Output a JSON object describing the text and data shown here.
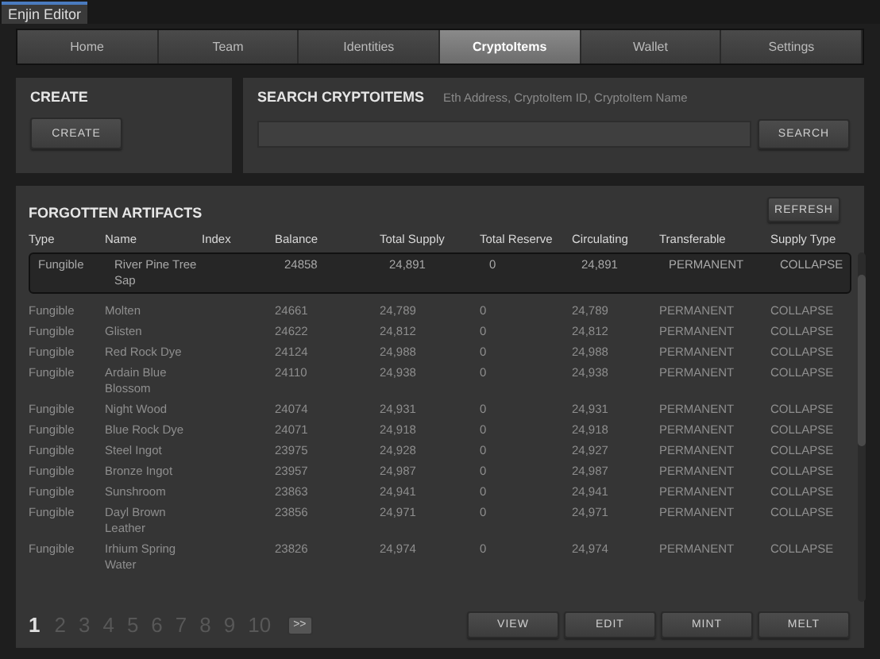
{
  "window": {
    "title": "Enjin Editor"
  },
  "tabs": [
    {
      "label": "Home",
      "selected": false
    },
    {
      "label": "Team",
      "selected": false
    },
    {
      "label": "Identities",
      "selected": false
    },
    {
      "label": "CryptoItems",
      "selected": true
    },
    {
      "label": "Wallet",
      "selected": false
    },
    {
      "label": "Settings",
      "selected": false
    }
  ],
  "create": {
    "title": "CREATE",
    "button": "CREATE"
  },
  "search": {
    "title": "SEARCH CRYPTOITEMS",
    "hint": "Eth Address, CryptoItem ID, CryptoItem Name",
    "button": "SEARCH"
  },
  "table": {
    "title": "FORGOTTEN ARTIFACTS",
    "refresh": "REFRESH",
    "columns": [
      "Type",
      "Name",
      "Index",
      "Balance",
      "Total Supply",
      "Total Reserve",
      "Circulating",
      "Transferable",
      "Supply Type"
    ],
    "rows": [
      {
        "selected": true,
        "cells": [
          "Fungible",
          "River Pine Tree Sap",
          "",
          "24858",
          "24,891",
          "0",
          "24,891",
          "PERMANENT",
          "COLLAPSE"
        ]
      },
      {
        "selected": false,
        "cells": [
          "Fungible",
          "Molten",
          "",
          "24661",
          "24,789",
          "0",
          "24,789",
          "PERMANENT",
          "COLLAPSE"
        ]
      },
      {
        "selected": false,
        "cells": [
          "Fungible",
          "Glisten",
          "",
          "24622",
          "24,812",
          "0",
          "24,812",
          "PERMANENT",
          "COLLAPSE"
        ]
      },
      {
        "selected": false,
        "cells": [
          "Fungible",
          "Red Rock Dye",
          "",
          "24124",
          "24,988",
          "0",
          "24,988",
          "PERMANENT",
          "COLLAPSE"
        ]
      },
      {
        "selected": false,
        "cells": [
          "Fungible",
          "Ardain Blue Blossom",
          "",
          "24110",
          "24,938",
          "0",
          "24,938",
          "PERMANENT",
          "COLLAPSE"
        ]
      },
      {
        "selected": false,
        "cells": [
          "Fungible",
          "Night Wood",
          "",
          "24074",
          "24,931",
          "0",
          "24,931",
          "PERMANENT",
          "COLLAPSE"
        ]
      },
      {
        "selected": false,
        "cells": [
          "Fungible",
          "Blue Rock Dye",
          "",
          "24071",
          "24,918",
          "0",
          "24,918",
          "PERMANENT",
          "COLLAPSE"
        ]
      },
      {
        "selected": false,
        "cells": [
          "Fungible",
          "Steel Ingot",
          "",
          "23975",
          "24,928",
          "0",
          "24,927",
          "PERMANENT",
          "COLLAPSE"
        ]
      },
      {
        "selected": false,
        "cells": [
          "Fungible",
          "Bronze Ingot",
          "",
          "23957",
          "24,987",
          "0",
          "24,987",
          "PERMANENT",
          "COLLAPSE"
        ]
      },
      {
        "selected": false,
        "cells": [
          "Fungible",
          "Sunshroom",
          "",
          "23863",
          "24,941",
          "0",
          "24,941",
          "PERMANENT",
          "COLLAPSE"
        ]
      },
      {
        "selected": false,
        "cells": [
          "Fungible",
          "Dayl Brown Leather",
          "",
          "23856",
          "24,971",
          "0",
          "24,971",
          "PERMANENT",
          "COLLAPSE"
        ]
      },
      {
        "selected": false,
        "cells": [
          "Fungible",
          "Irhium Spring Water",
          "",
          "23826",
          "24,974",
          "0",
          "24,974",
          "PERMANENT",
          "COLLAPSE"
        ]
      }
    ]
  },
  "pagination": {
    "pages": [
      {
        "label": "1",
        "selected": true
      },
      {
        "label": "2",
        "selected": false
      },
      {
        "label": "3",
        "selected": false
      },
      {
        "label": "4",
        "selected": false
      },
      {
        "label": "5",
        "selected": false
      },
      {
        "label": "6",
        "selected": false
      },
      {
        "label": "7",
        "selected": false
      },
      {
        "label": "8",
        "selected": false
      },
      {
        "label": "9",
        "selected": false
      },
      {
        "label": "10",
        "selected": false
      }
    ],
    "next": ">>"
  },
  "actions": [
    "VIEW",
    "EDIT",
    "MINT",
    "MELT"
  ]
}
